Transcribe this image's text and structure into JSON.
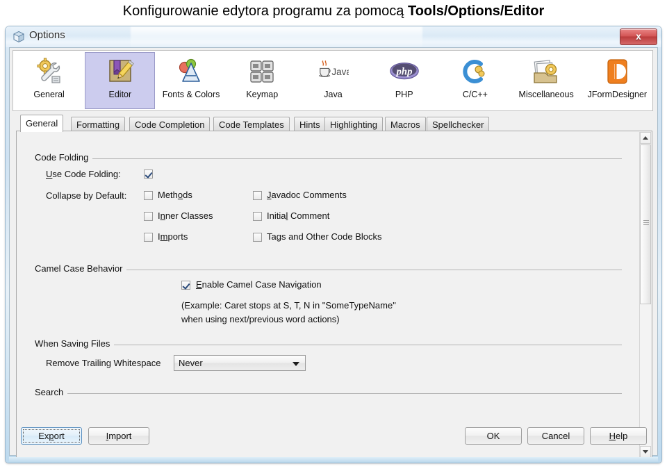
{
  "page": {
    "heading_plain": "Konfigurowanie edytora programu za pomocą ",
    "heading_bold": "Tools/Options/Editor"
  },
  "window": {
    "title": "Options",
    "title_icon": "cube-icon",
    "close_label": "x"
  },
  "toolbar": {
    "categories": [
      {
        "label": "General",
        "icon": "gear-wrench-icon",
        "selected": false
      },
      {
        "label": "Editor",
        "icon": "notebook-pencil-icon",
        "selected": true
      },
      {
        "label": "Fonts & Colors",
        "icon": "font-palette-icon",
        "selected": false
      },
      {
        "label": "Keymap",
        "icon": "keyboard-keys-icon",
        "selected": false
      },
      {
        "label": "Java",
        "icon": "java-cup-icon",
        "selected": false
      },
      {
        "label": "PHP",
        "icon": "php-logo-icon",
        "selected": false
      },
      {
        "label": "C/C++",
        "icon": "c-plus-plus-icon",
        "selected": false
      },
      {
        "label": "Miscellaneous",
        "icon": "folder-gear-icon",
        "selected": false
      },
      {
        "label": "JFormDesigner",
        "icon": "jformdesigner-icon",
        "selected": false
      }
    ]
  },
  "tabs": [
    {
      "label": "General",
      "selected": true
    },
    {
      "label": "Formatting",
      "selected": false
    },
    {
      "label": "Code Completion",
      "selected": false
    },
    {
      "label": "Code Templates",
      "selected": false
    },
    {
      "label": "Hints",
      "selected": false
    },
    {
      "label": "Highlighting",
      "selected": false
    },
    {
      "label": "Macros",
      "selected": false
    },
    {
      "label": "Spellchecker",
      "selected": false
    }
  ],
  "sections": {
    "code_folding": {
      "title": "Code Folding",
      "use_code_folding_label": "Use Code Folding:",
      "use_code_folding_checked": true,
      "collapse_label": "Collapse by Default:",
      "options_col1": [
        {
          "label": "Methods",
          "checked": false
        },
        {
          "label": "Inner Classes",
          "checked": false
        },
        {
          "label": "Imports",
          "checked": false
        }
      ],
      "options_col2": [
        {
          "label": "Javadoc Comments",
          "checked": false
        },
        {
          "label": "Initial Comment",
          "checked": false
        },
        {
          "label": "Tags and Other Code Blocks",
          "checked": false
        }
      ]
    },
    "camel_case": {
      "title": "Camel Case  Behavior",
      "enable_label": "Enable Camel Case Navigation",
      "enable_checked": true,
      "example_line1": "(Example: Caret stops at S, T, N in \"SomeTypeName\"",
      "example_line2": "when using next/previous word actions)"
    },
    "when_saving": {
      "title": "When Saving Files",
      "remove_trailing_label": "Remove Trailing Whitespace",
      "remove_trailing_value": "Never"
    },
    "search": {
      "title": "Search"
    }
  },
  "scrollbar": {
    "up_arrow": "scroll-up-arrow-icon",
    "down_arrow": "scroll-down-arrow-icon"
  },
  "buttons": {
    "export": "Export",
    "import": "Import",
    "ok": "OK",
    "cancel": "Cancel",
    "help": "Help"
  },
  "colors": {
    "selected_category_bg": "#ccccee",
    "close_button": "#bb3c3c",
    "panel_bg": "#f1f1f1"
  }
}
